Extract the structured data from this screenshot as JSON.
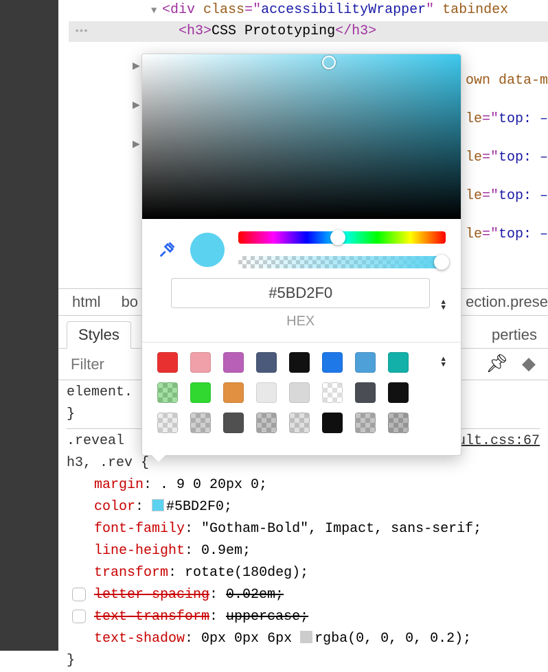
{
  "dom": {
    "line1_tag": "div",
    "line1_attr1_name": "class",
    "line1_attr1_val": "accessibilityWrapper",
    "line1_attr2_name": "tabindex",
    "line2_tag": "h3",
    "line2_text": "CSS Prototyping",
    "more_attr_partial": "own data-m",
    "more_attr_name": "le",
    "more_attr_val": "top: –",
    "breadcrumb_left_partial": "ection.prese"
  },
  "breadcrumb": [
    "html",
    "bo"
  ],
  "tabs": {
    "active": "Styles",
    "other": "perties"
  },
  "filter": {
    "placeholder": "Filter"
  },
  "color_picker": {
    "hex_value": "#5BD2F0",
    "format_label": "HEX",
    "swatches": [
      [
        "#e93030",
        "#f0a0a8",
        "#b860b8",
        "#4b5a7a",
        "#111111",
        "#1e78e8",
        "#4ea0d8",
        "#12b0a8"
      ],
      [
        "#48c048:half",
        "#30d830",
        "#e09040",
        "#e8e8e8",
        "#d8d8d8",
        "#ffffff:half",
        "#4a4e54",
        "#111111"
      ],
      [
        "#d8d8d8:half",
        "#a0a0a0:half",
        "#505050",
        "#888888:half",
        "#c0c0c0:half",
        "#0f0f0f",
        "#8a8a8a:half",
        "#707070:half"
      ]
    ]
  },
  "styles": {
    "element_selector": "element.",
    "rule1": {
      "selector_a": ".reveal",
      "selector_b": "h3",
      "selector_c": ", .rev",
      "link": "ult.css:67",
      "decls": [
        {
          "name": "margin",
          "val": ". 9 0 20px 0;"
        },
        {
          "name": "color",
          "val": "#5BD2F0;",
          "swatch": "#5BD2F0"
        },
        {
          "name": "font-family",
          "val": "\"Gotham-Bold\", Impact, sans-serif;"
        },
        {
          "name": "line-height",
          "val": "0.9em;"
        },
        {
          "name": "transform",
          "val": "rotate(180deg);"
        },
        {
          "name": "letter-spacing",
          "val": "0.02em;",
          "over": true,
          "cb": true
        },
        {
          "name": "text-transform",
          "val": "uppercase;",
          "over": true,
          "cb": true
        },
        {
          "name": "text-shadow",
          "val_pre": "0px 0px 6px ",
          "swatch2": "#cccccc",
          "val_post": "rgba(0, 0, 0, 0.2);"
        }
      ]
    }
  }
}
